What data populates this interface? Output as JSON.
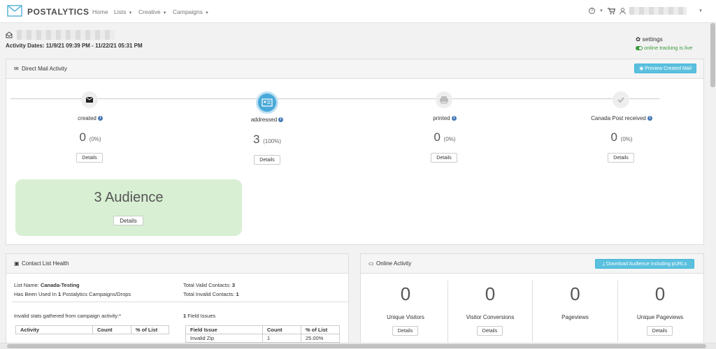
{
  "nav": {
    "brand": "POSTALYTICS",
    "home": "Home",
    "lists": "Lists",
    "creative": "Creative",
    "campaigns": "Campaigns",
    "help_icon": "?"
  },
  "header": {
    "activity_dates": "Activity Dates: 11/9/21 09:39 PM - 11/22/21 05:31 PM",
    "settings": "settings",
    "tracking": "online tracking is live"
  },
  "direct_mail": {
    "title": "Direct Mail Activity",
    "preview_button": "Preview Created Mail",
    "stages": [
      {
        "label": "created",
        "count": "0",
        "pct": "(0%)",
        "details": "Details",
        "icon": "envelope-icon"
      },
      {
        "label": "addressed",
        "count": "3",
        "pct": "(100%)",
        "details": "Details",
        "icon": "address-card-icon"
      },
      {
        "label": "printed",
        "count": "0",
        "pct": "(0%)",
        "details": "Details",
        "icon": "printer-icon"
      },
      {
        "label": "Canada Post received",
        "count": "0",
        "pct": "(0%)",
        "details": "Details",
        "icon": "check-icon"
      }
    ],
    "audience": "3 Audience",
    "audience_details": "Details"
  },
  "contact_health": {
    "title": "Contact List Health",
    "list_name_label": "List Name: ",
    "list_name": "Canada-Testing",
    "used_prefix": "Has Been Used In ",
    "used_count": "1",
    "used_suffix": " Postalytics Campaigns/Drops",
    "valid_label": "Total Valid Contacts: ",
    "valid_count": "3",
    "invalid_label": "Total Invalid Contacts: ",
    "invalid_count": "1",
    "invalid_stats": "Invalid stats gathered from campaign activity:*",
    "activity_headers": [
      "Activity",
      "Count",
      "% of List"
    ],
    "field_issues_count": "1",
    "field_issues_label": " Field Issues",
    "field_headers": [
      "Field Issue",
      "Count",
      "% of List"
    ],
    "field_rows": [
      [
        "Invalid Zip",
        "1",
        "25.00%"
      ]
    ]
  },
  "online_activity": {
    "title": "Online Activity",
    "download_button": "Download Audience Including pURLs",
    "metrics": [
      {
        "value": "0",
        "label": "Unique Visitors",
        "details": "Details"
      },
      {
        "value": "0",
        "label": "Visitor Conversions",
        "details": "Details"
      },
      {
        "value": "0",
        "label": "Pageviews"
      },
      {
        "value": "0",
        "label": "Unique Pageviews",
        "details": "Details"
      }
    ]
  },
  "colors": {
    "accent": "#5bc0de",
    "audience_bg": "#d8efd3",
    "live": "#3c9a3c",
    "active_stage": "#49a9d9"
  }
}
